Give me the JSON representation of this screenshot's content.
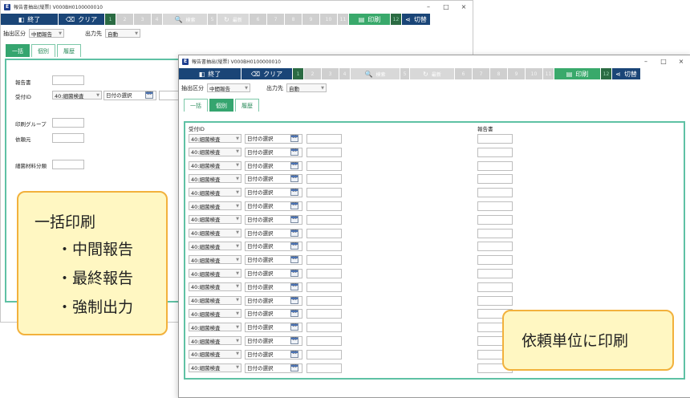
{
  "window_title": "報告書抽出(縦票) V000BH0100000010",
  "window_controls": {
    "minimize": "–",
    "maximize": "□",
    "close": "×"
  },
  "toolbar": {
    "exit_label": "終了",
    "clear_label": "クリア",
    "search_label": "検索",
    "refresh_label": "最新",
    "print_label": "印刷",
    "switch_label": "切替",
    "fn_keys": [
      "1",
      "2",
      "3",
      "4",
      "5",
      "6",
      "7",
      "8",
      "9",
      "10",
      "11",
      "12"
    ]
  },
  "filters": {
    "extract_label": "抽出区分",
    "extract_value": "中間報告",
    "output_label": "出力先",
    "output_value": "自動"
  },
  "tabs": [
    "一括",
    "個別",
    "履歴"
  ],
  "back_form": {
    "report_label": "報告書",
    "receipt_label": "受付ID",
    "receipt_select": "40:細菌検査",
    "date_placeholder": "日付の選択",
    "print_group_label": "印刷グループ",
    "requester_label": "依頼元",
    "bacteria_material_label": "細菌材料分類"
  },
  "front_form": {
    "receipt_header": "受付ID",
    "report_header": "報告書",
    "row_select": "40:細菌検査",
    "row_date": "日付の選択",
    "row_count": 18
  },
  "callout_bulk": {
    "title": "一括印刷",
    "items": [
      "・中間報告",
      "・最終報告",
      "・強制出力"
    ]
  },
  "callout_individual": {
    "text": "依頼単位に印刷"
  },
  "calendar_glyph": "15"
}
